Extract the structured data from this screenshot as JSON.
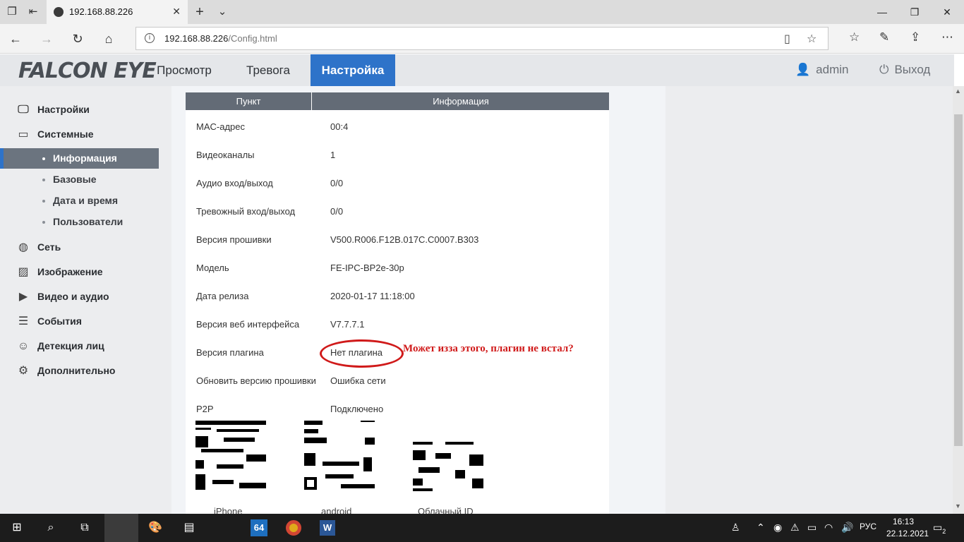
{
  "browser": {
    "tab_title": "192.168.88.226",
    "url_host": "192.168.88.226",
    "url_path": "/Config.html"
  },
  "app": {
    "logo": "FALCON EYE",
    "nav": [
      {
        "label": "Просмотр"
      },
      {
        "label": "Тревога"
      },
      {
        "label": "Настройка"
      }
    ],
    "user": "admin",
    "logout": "Выход"
  },
  "sidebar": {
    "items": [
      {
        "label": "Настройки",
        "icon": "monitor-icon"
      },
      {
        "label": "Системные",
        "icon": "system-icon"
      },
      {
        "label": "Сеть",
        "icon": "globe-icon"
      },
      {
        "label": "Изображение",
        "icon": "image-icon"
      },
      {
        "label": "Видео и аудио",
        "icon": "video-icon"
      },
      {
        "label": "События",
        "icon": "events-icon"
      },
      {
        "label": "Детекция лиц",
        "icon": "face-icon"
      },
      {
        "label": "Дополнительно",
        "icon": "gear-icon"
      }
    ],
    "sub": [
      {
        "label": "Информация",
        "active": true
      },
      {
        "label": "Базовые"
      },
      {
        "label": "Дата и время"
      },
      {
        "label": "Пользователи"
      }
    ]
  },
  "table": {
    "headers": [
      "Пункт",
      "Информация"
    ],
    "rows": [
      {
        "label": "MAC-адрес",
        "value": "00:4"
      },
      {
        "label": "Видеоканалы",
        "value": "1"
      },
      {
        "label": "Аудио вход/выход",
        "value": "0/0"
      },
      {
        "label": "Тревожный вход/выход",
        "value": "0/0"
      },
      {
        "label": "Версия прошивки",
        "value": "V500.R006.F12B.017C.C0007.B303"
      },
      {
        "label": "Модель",
        "value": "FE-IPC-BP2e-30p"
      },
      {
        "label": "Дата релиза",
        "value": "2020-01-17 11:18:00"
      },
      {
        "label": "Версия веб интерфейса",
        "value": "V7.7.7.1"
      },
      {
        "label": "Версия плагина",
        "value": "Нет плагина"
      },
      {
        "label": "Обновить версию прошивки",
        "value": "Ошибка сети"
      },
      {
        "label": "P2P",
        "value": "Подключено"
      }
    ]
  },
  "annotation": "Может изза этого, плагин не встал?",
  "qr_codes": [
    {
      "label": "iPhone"
    },
    {
      "label": "android"
    },
    {
      "label": "Облачный ID"
    }
  ],
  "taskbar": {
    "lang": "РУС",
    "time": "16:13",
    "date": "22.12.2021",
    "notifications": "2",
    "app_badge": "64"
  },
  "colors": {
    "accent": "#2e73c9",
    "table_header": "#636b76",
    "annotation": "#d01a1a"
  }
}
